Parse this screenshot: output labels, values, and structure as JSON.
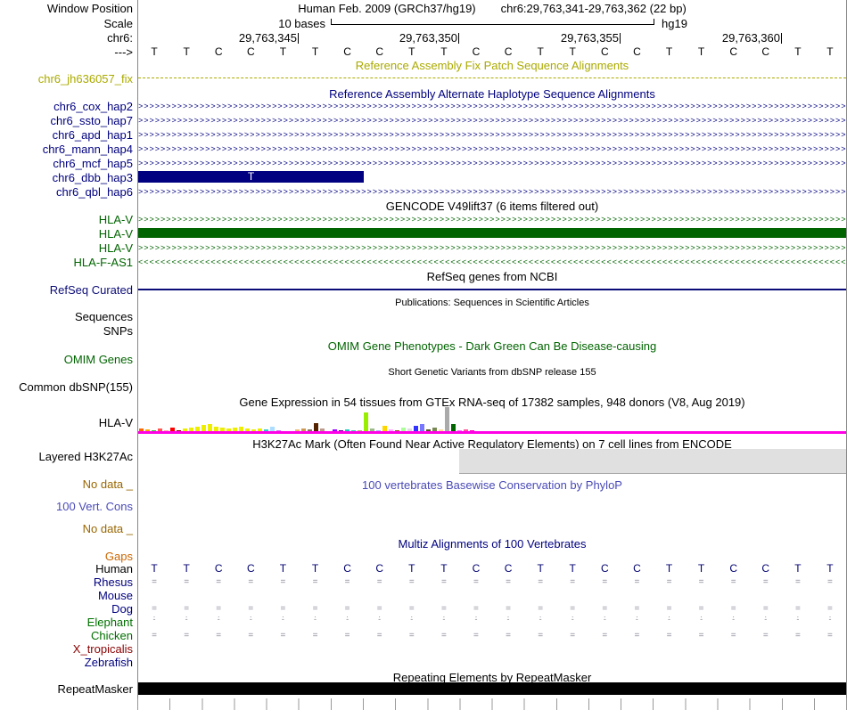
{
  "colors": {
    "black": "#000000",
    "fix_olive": "#aaaa00",
    "hap_navy": "#000080",
    "gene_green": "#006400",
    "refseq_blue": "#0c0c78",
    "omim_green": "#006400",
    "no_data_brown": "#996600",
    "phylop_blue": "#4a4ab8",
    "gaps_orange": "#cc6600",
    "gtex_magenta": "#ff00e6",
    "repeat_black": "#000000",
    "species_navy": "#000080",
    "species_green": "#007000",
    "species_maroon": "#8b0000"
  },
  "header": {
    "window_position_label": "Window Position",
    "genome_title": "Human Feb. 2009 (GRCh37/hg19)",
    "position": "chr6:29,763,341-29,763,362 (22 bp)",
    "scale_label": "Scale",
    "scale_bar_label": "10 bases",
    "assembly_tag": "hg19",
    "chrom_label": "chr6:",
    "coordinate_ticks": [
      "29,763,345",
      "29,763,350",
      "29,763,355",
      "29,763,360"
    ],
    "strand_label": "--->",
    "sequence": [
      "T",
      "T",
      "C",
      "C",
      "T",
      "T",
      "C",
      "C",
      "T",
      "T",
      "C",
      "C",
      "T",
      "T",
      "C",
      "C",
      "T",
      "T",
      "C",
      "C",
      "T",
      "T"
    ]
  },
  "fix_patch": {
    "title": "Reference Assembly Fix Patch Sequence Alignments",
    "track_label": "chr6_jh636057_fix"
  },
  "alt_haplotypes": {
    "title": "Reference Assembly Alternate Haplotype Sequence Alignments",
    "items": [
      {
        "label": "chr6_cox_hap2"
      },
      {
        "label": "chr6_ssto_hap7"
      },
      {
        "label": "chr6_apd_hap1"
      },
      {
        "label": "chr6_mann_hap4"
      },
      {
        "label": "chr6_mcf_hap5"
      },
      {
        "label": "chr6_dbb_hap3",
        "bar_label": "T"
      },
      {
        "label": "chr6_qbl_hap6"
      }
    ]
  },
  "gencode": {
    "title": "GENCODE V49lift37 (6 items filtered out)",
    "items": [
      {
        "label": "HLA-V"
      },
      {
        "label": "HLA-V"
      },
      {
        "label": "HLA-V"
      },
      {
        "label": "HLA-F-AS1"
      }
    ]
  },
  "refseq": {
    "title": "RefSeq genes from NCBI",
    "track_label": "RefSeq Curated"
  },
  "publications": {
    "title": "Publications: Sequences in Scientific Articles",
    "track_label": "Sequences"
  },
  "snps": {
    "track_label": "SNPs"
  },
  "omim": {
    "title": "OMIM Gene Phenotypes - Dark Green Can Be Disease-causing",
    "track_label": "OMIM Genes"
  },
  "dbsnp": {
    "title": "Short Genetic Variants from dbSNP release 155",
    "track_label": "Common dbSNP(155)"
  },
  "gtex": {
    "title": "Gene Expression in 54 tissues from GTEx RNA-seq of 17382 samples, 948 donors (V8, Aug 2019)",
    "track_label": "HLA-V",
    "bars": [
      {
        "h": 4,
        "c": "#ff6600"
      },
      {
        "h": 3,
        "c": "#ffaa00"
      },
      {
        "h": 2,
        "c": "#33cc33"
      },
      {
        "h": 4,
        "c": "#ff5555"
      },
      {
        "h": 2,
        "c": "#ffaa99"
      },
      {
        "h": 5,
        "c": "#ff0000"
      },
      {
        "h": 2,
        "c": "#990000"
      },
      {
        "h": 4,
        "c": "#eeee00"
      },
      {
        "h": 5,
        "c": "#eeee00"
      },
      {
        "h": 6,
        "c": "#eeee00"
      },
      {
        "h": 8,
        "c": "#eeee00"
      },
      {
        "h": 9,
        "c": "#eeee00"
      },
      {
        "h": 6,
        "c": "#eeee00"
      },
      {
        "h": 5,
        "c": "#eeee00"
      },
      {
        "h": 4,
        "c": "#eeee00"
      },
      {
        "h": 5,
        "c": "#eeee00"
      },
      {
        "h": 6,
        "c": "#eeee00"
      },
      {
        "h": 4,
        "c": "#eeee00"
      },
      {
        "h": 3,
        "c": "#eeee00"
      },
      {
        "h": 4,
        "c": "#eeee00"
      },
      {
        "h": 3,
        "c": "#33cccc"
      },
      {
        "h": 6,
        "c": "#aaddff"
      },
      {
        "h": 2,
        "c": "#cc66ff"
      },
      {
        "h": 1,
        "c": "#ffcccc"
      },
      {
        "h": 1,
        "c": "#ccaadd"
      },
      {
        "h": 3,
        "c": "#eebb77"
      },
      {
        "h": 4,
        "c": "#cc9955"
      },
      {
        "h": 3,
        "c": "#8b7355"
      },
      {
        "h": 10,
        "c": "#552200"
      },
      {
        "h": 4,
        "c": "#bb9988"
      },
      {
        "h": 1,
        "c": "#ffcccc"
      },
      {
        "h": 3,
        "c": "#9900ff"
      },
      {
        "h": 2,
        "c": "#660099"
      },
      {
        "h": 3,
        "c": "#22ccbb"
      },
      {
        "h": 2,
        "c": "#33ccaa"
      },
      {
        "h": 2,
        "c": "#aabb66"
      },
      {
        "h": 22,
        "c": "#99ee00"
      },
      {
        "h": 4,
        "c": "#99bb88"
      },
      {
        "h": 2,
        "c": "#aaaaff"
      },
      {
        "h": 7,
        "c": "#ffd700"
      },
      {
        "h": 3,
        "c": "#ffaaff"
      },
      {
        "h": 2,
        "c": "#995522"
      },
      {
        "h": 5,
        "c": "#aaff99"
      },
      {
        "h": 4,
        "c": "#dddddd"
      },
      {
        "h": 7,
        "c": "#3333ff"
      },
      {
        "h": 9,
        "c": "#7777ff"
      },
      {
        "h": 3,
        "c": "#555522"
      },
      {
        "h": 5,
        "c": "#778855"
      },
      {
        "h": 3,
        "c": "#ffdd99"
      },
      {
        "h": 28,
        "c": "#aaaaaa"
      },
      {
        "h": 9,
        "c": "#006600"
      },
      {
        "h": 2,
        "c": "#ff66ff"
      },
      {
        "h": 3,
        "c": "#ff5599"
      },
      {
        "h": 2,
        "c": "#ff00bb"
      }
    ]
  },
  "h3k27ac": {
    "title": "H3K27Ac Mark (Often Found Near Active Regulatory Elements) on 7 cell lines from ENCODE",
    "track_label": "Layered H3K27Ac",
    "no_data_label": "No data _"
  },
  "conservation": {
    "title": "100 vertebrates Basewise Conservation by PhyloP",
    "track_label": "100 Vert. Cons",
    "no_data_label": "No data _"
  },
  "multiz": {
    "title": "Multiz Alignments of 100 Vertebrates",
    "gaps_label": "Gaps",
    "rows": [
      {
        "label": "Human",
        "type": "sequence"
      },
      {
        "label": "Rhesus",
        "type": "marks",
        "mark": "="
      },
      {
        "label": "Mouse",
        "type": "blank"
      },
      {
        "label": "Dog",
        "type": "marks",
        "mark": "="
      },
      {
        "label": "Elephant",
        "type": "marks",
        "mark": ".-"
      },
      {
        "label": "Chicken",
        "type": "marks",
        "mark": "="
      },
      {
        "label": "X_tropicalis",
        "type": "blank"
      },
      {
        "label": "Zebrafish",
        "type": "blank"
      }
    ]
  },
  "repeatmasker": {
    "title": "Repeating Elements by RepeatMasker",
    "track_label": "RepeatMasker"
  }
}
